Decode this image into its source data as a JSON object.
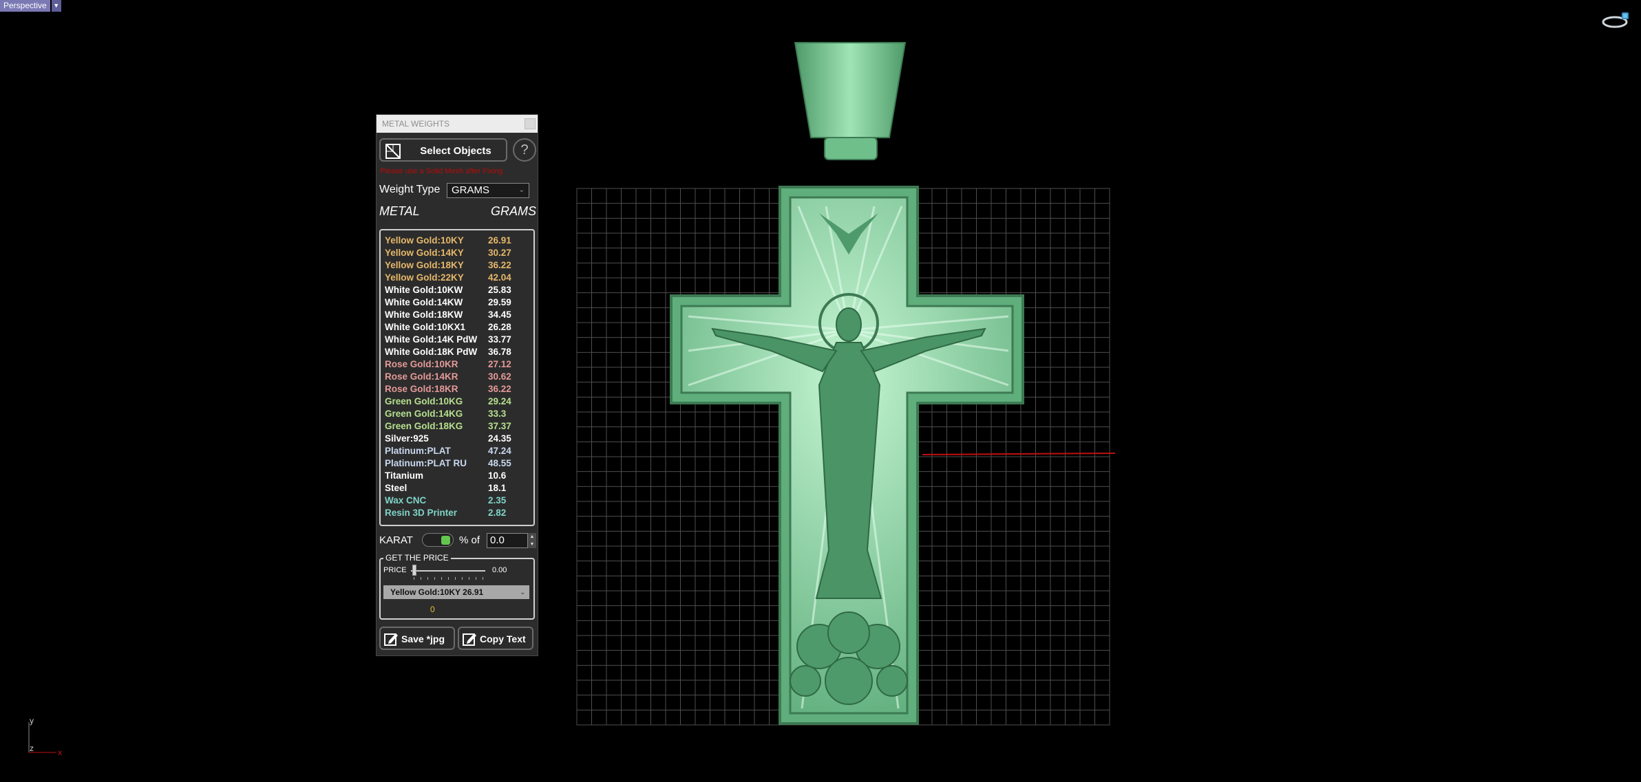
{
  "viewport": {
    "name": "Perspective"
  },
  "axis": {
    "y": "y",
    "z": "z",
    "x": "x"
  },
  "panel": {
    "title": "METAL WEIGHTS",
    "select_objects": "Select Objects",
    "help": "?",
    "warning": "Please use a Solid Mesh after Fixing",
    "weight_type_label": "Weight Type",
    "weight_type_value": "GRAMS",
    "header_metal": "METAL",
    "header_grams": "GRAMS",
    "metals": [
      {
        "name": "Yellow Gold:10KY",
        "grams": "26.91",
        "color": "#e6b86a"
      },
      {
        "name": "Yellow Gold:14KY",
        "grams": "30.27",
        "color": "#e6b86a"
      },
      {
        "name": "Yellow Gold:18KY",
        "grams": "36.22",
        "color": "#e6b86a"
      },
      {
        "name": "Yellow Gold:22KY",
        "grams": "42.04",
        "color": "#e6b86a"
      },
      {
        "name": "White Gold:10KW",
        "grams": "25.83",
        "color": "#ffffff"
      },
      {
        "name": "White Gold:14KW",
        "grams": "29.59",
        "color": "#ffffff"
      },
      {
        "name": "White Gold:18KW",
        "grams": "34.45",
        "color": "#ffffff"
      },
      {
        "name": "White Gold:10KX1",
        "grams": "26.28",
        "color": "#ffffff"
      },
      {
        "name": "White Gold:14K PdW",
        "grams": "33.77",
        "color": "#ffffff"
      },
      {
        "name": "White Gold:18K PdW",
        "grams": "36.78",
        "color": "#ffffff"
      },
      {
        "name": "Rose Gold:10KR",
        "grams": "27.12",
        "color": "#e49a98"
      },
      {
        "name": "Rose Gold:14KR",
        "grams": "30.62",
        "color": "#e49a98"
      },
      {
        "name": "Rose Gold:18KR",
        "grams": "36.22",
        "color": "#e49a98"
      },
      {
        "name": "Green Gold:10KG",
        "grams": "29.24",
        "color": "#b6e08e"
      },
      {
        "name": "Green Gold:14KG",
        "grams": "33.3",
        "color": "#b6e08e"
      },
      {
        "name": "Green Gold:18KG",
        "grams": "37.37",
        "color": "#b6e08e"
      },
      {
        "name": "Silver:925",
        "grams": "24.35",
        "color": "#ffffff"
      },
      {
        "name": "Platinum:PLAT",
        "grams": "47.24",
        "color": "#c9d8f0"
      },
      {
        "name": "Platinum:PLAT RU",
        "grams": "48.55",
        "color": "#c9d8f0"
      },
      {
        "name": "Titanium",
        "grams": "10.6",
        "color": "#ffffff"
      },
      {
        "name": "Steel",
        "grams": "18.1",
        "color": "#ffffff"
      },
      {
        "name": "Wax  CNC",
        "grams": "2.35",
        "color": "#7fd4c8"
      },
      {
        "name": "Resin 3D Printer",
        "grams": "2.82",
        "color": "#7fd4c8"
      }
    ],
    "karat_label": "KARAT",
    "percent_of": "% of",
    "percent_value": "0.0",
    "price_legend": "GET THE PRICE",
    "price_label": "PRICE",
    "price_value": "0.00",
    "price_slider_level": 0,
    "price_select": "Yellow Gold:10KY 26.91",
    "price_result": "0",
    "save_jpg": "Save *jpg",
    "copy_text": "Copy Text"
  },
  "colors": {
    "model_green": "#7fcf98",
    "grid": "#5a5a5a",
    "x_axis": "#c01010"
  }
}
